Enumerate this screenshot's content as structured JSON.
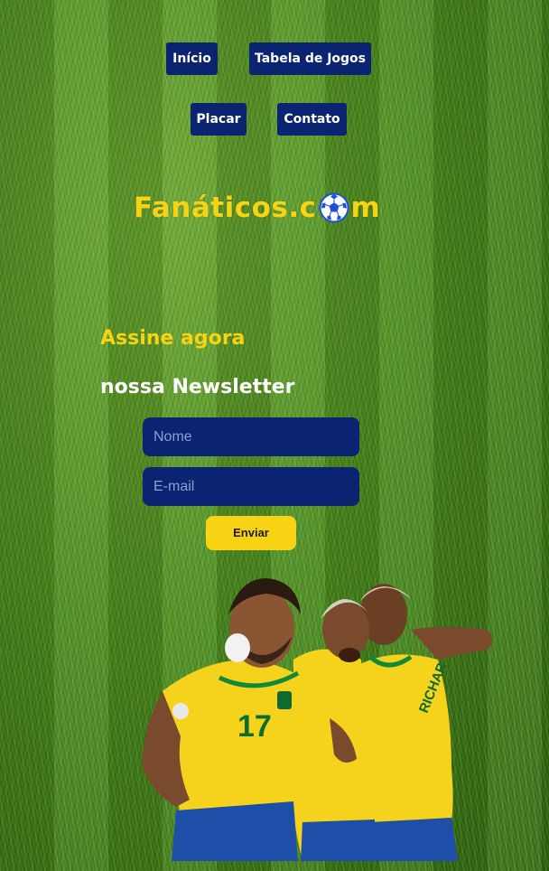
{
  "nav": {
    "items": [
      {
        "label": "Início"
      },
      {
        "label": "Tabela de Jogos"
      },
      {
        "label": "Placar"
      },
      {
        "label": "Contato"
      }
    ]
  },
  "logo": {
    "text_before": "Fanáticos.c",
    "icon": "soccer-ball-icon",
    "text_after": "m"
  },
  "newsletter": {
    "title": "Assine agora",
    "subtitle": "nossa Newsletter",
    "name_placeholder": "Nome",
    "email_placeholder": "E-mail",
    "submit_label": "Enviar"
  },
  "image": {
    "subject": "players-celebrating",
    "jersey_number": "17"
  },
  "colors": {
    "navy": "#0a2471",
    "yellow": "#f7d314",
    "white": "#ffffff",
    "grass": "#4a8a1f"
  }
}
